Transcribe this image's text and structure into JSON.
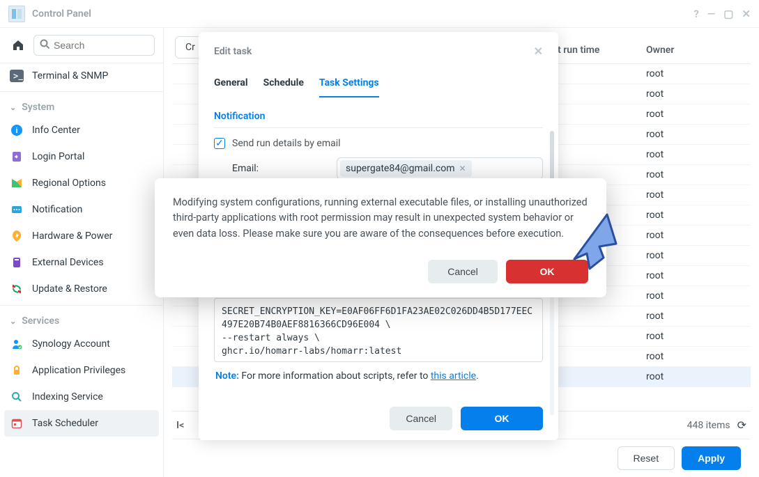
{
  "window": {
    "title": "Control Panel"
  },
  "search": {
    "placeholder": "Search"
  },
  "sidebar": {
    "top": [
      {
        "label": "Terminal & SNMP"
      }
    ],
    "groups": [
      {
        "title": "System",
        "items": [
          {
            "label": "Info Center"
          },
          {
            "label": "Login Portal"
          },
          {
            "label": "Regional Options"
          },
          {
            "label": "Notification"
          },
          {
            "label": "Hardware & Power"
          },
          {
            "label": "External Devices"
          },
          {
            "label": "Update & Restore"
          }
        ]
      },
      {
        "title": "Services",
        "items": [
          {
            "label": "Synology Account"
          },
          {
            "label": "Application Privileges"
          },
          {
            "label": "Indexing Service"
          },
          {
            "label": "Task Scheduler",
            "active": true
          }
        ]
      }
    ]
  },
  "toolbar": {
    "create_label": "Cr"
  },
  "table": {
    "headers": {
      "next_run": "xt run time",
      "owner": "Owner"
    },
    "owner_value": "root",
    "row_count": 16,
    "items_label": "448 items"
  },
  "edit_dialog": {
    "title": "Edit task",
    "tabs": {
      "general": "General",
      "schedule": "Schedule",
      "settings": "Task Settings"
    },
    "section_notification": "Notification",
    "send_email_label": "Send run details by email",
    "email_label": "Email:",
    "email_value": "supergate84@gmail.com",
    "script_tail": "SECRET_ENCRYPTION_KEY=E0AF06FF6D1FA23AE02C026DD4B5D177EEC497E20B74B0AEF8816366CD96E004 \\\n--restart always \\\nghcr.io/homarr-labs/homarr:latest",
    "note_prefix": "Note:",
    "note_text": " For more information about scripts, refer to ",
    "note_link": "this article",
    "note_suffix": ".",
    "cancel": "Cancel",
    "ok": "OK"
  },
  "confirm": {
    "text": "Modifying system configurations, running external executable files, or installing unauthorized third-party applications with root permission may result in unexpected system behavior or even data loss. Please make sure you are aware of the consequences before execution.",
    "cancel": "Cancel",
    "ok": "OK"
  },
  "footer": {
    "reset": "Reset",
    "apply": "Apply"
  }
}
